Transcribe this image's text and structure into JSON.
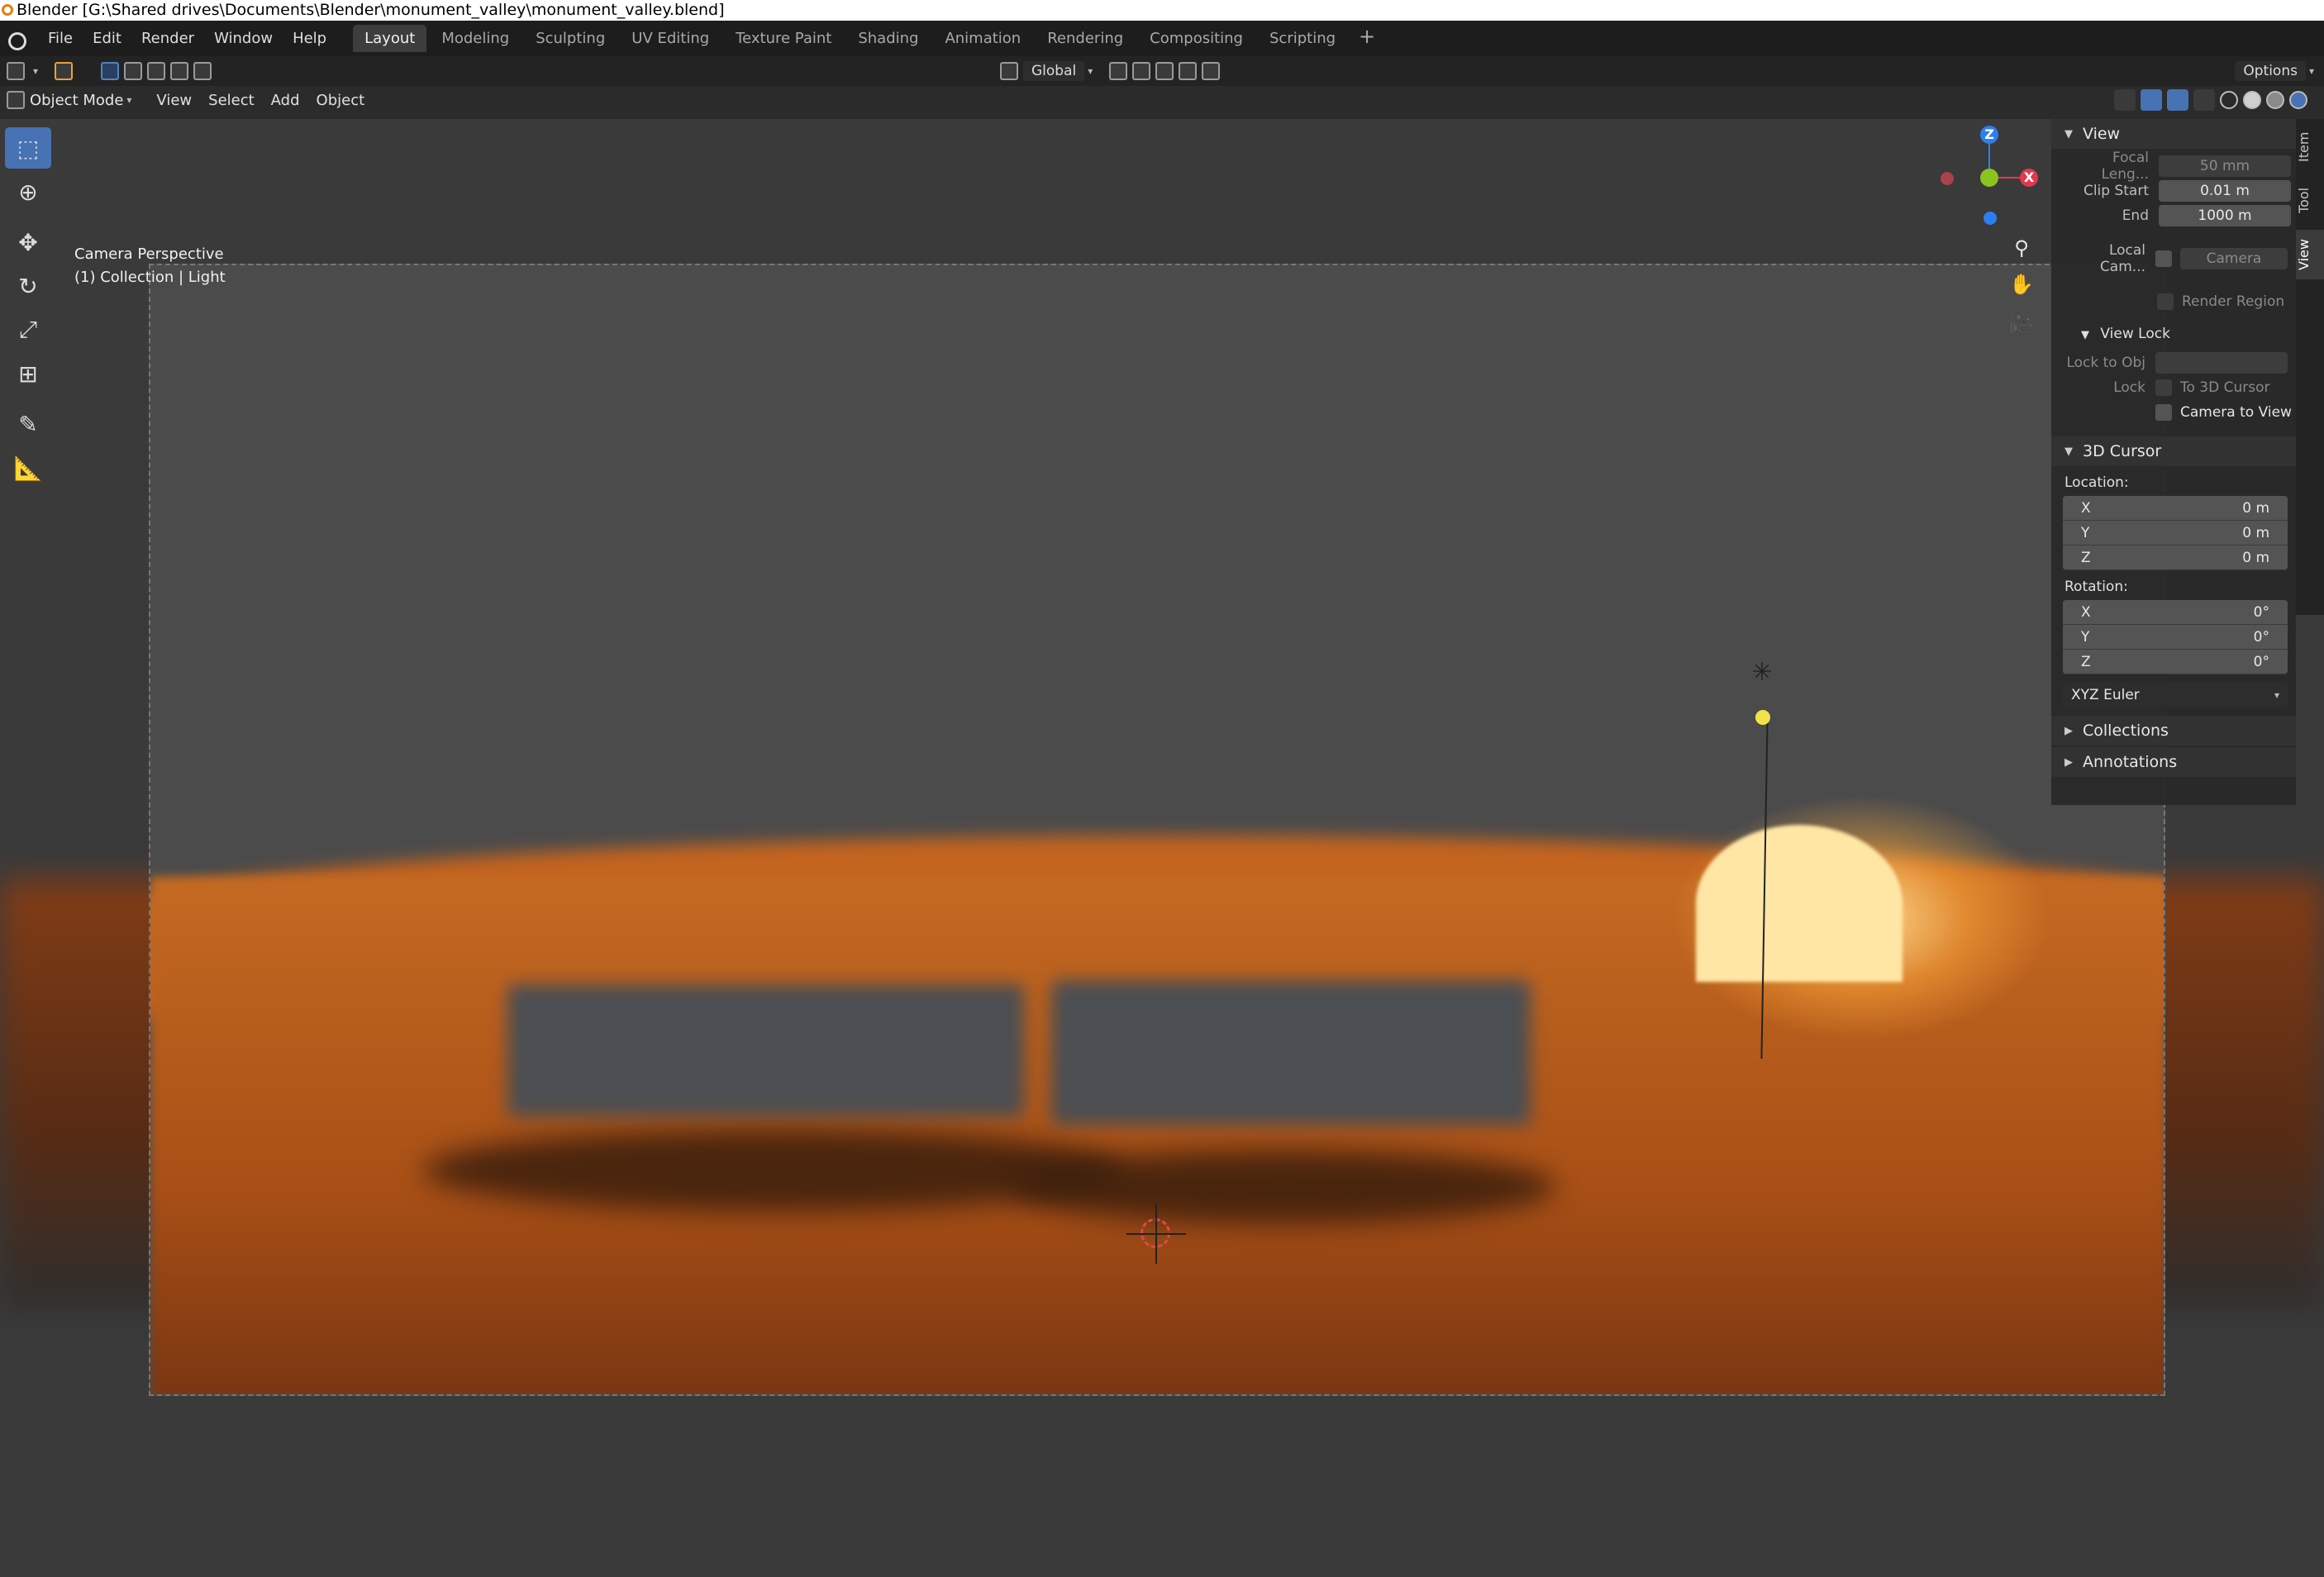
{
  "window": {
    "title": "Blender [G:\\Shared drives\\Documents\\Blender\\monument_valley\\monument_valley.blend]"
  },
  "menu": [
    "File",
    "Edit",
    "Render",
    "Window",
    "Help"
  ],
  "workspaces": [
    "Layout",
    "Modeling",
    "Sculpting",
    "UV Editing",
    "Texture Paint",
    "Shading",
    "Animation",
    "Rendering",
    "Compositing",
    "Scripting"
  ],
  "workspace_active": "Layout",
  "workspace_add": "+",
  "tool_header": {
    "orientation": "Global",
    "options": "Options"
  },
  "view_header": {
    "mode": "Object Mode",
    "menus": [
      "View",
      "Select",
      "Add",
      "Object"
    ]
  },
  "viewport": {
    "line1": "Camera Perspective",
    "line2": "(1) Collection | Light"
  },
  "gizmo": {
    "z": "Z",
    "x": "X"
  },
  "npanel": {
    "tabs": [
      "Item",
      "Tool",
      "View"
    ],
    "view_section": "View",
    "focal_label": "Focal Leng...",
    "focal_value": "50 mm",
    "clip_start_label": "Clip Start",
    "clip_start_value": "0.01 m",
    "clip_end_label": "End",
    "clip_end_value": "1000 m",
    "local_cam_label": "Local Cam...",
    "local_cam_value": "Camera",
    "render_region": "Render Region",
    "view_lock_section": "View Lock",
    "lock_to_obj": "Lock to Obj",
    "lock_label": "Lock",
    "to_3d_cursor": "To 3D Cursor",
    "camera_to_view": "Camera to View",
    "cursor_section": "3D Cursor",
    "location_label": "Location:",
    "location": [
      {
        "axis": "X",
        "value": "0 m"
      },
      {
        "axis": "Y",
        "value": "0 m"
      },
      {
        "axis": "Z",
        "value": "0 m"
      }
    ],
    "rotation_label": "Rotation:",
    "rotation": [
      {
        "axis": "X",
        "value": "0°"
      },
      {
        "axis": "Y",
        "value": "0°"
      },
      {
        "axis": "Z",
        "value": "0°"
      }
    ],
    "rotation_mode": "XYZ Euler",
    "collections": "Collections",
    "annotations": "Annotations"
  },
  "colors": {
    "accent": "#4772b3",
    "axis_x": "#e2394d",
    "axis_y": "#8bc41f",
    "axis_z": "#2c7ff0"
  }
}
